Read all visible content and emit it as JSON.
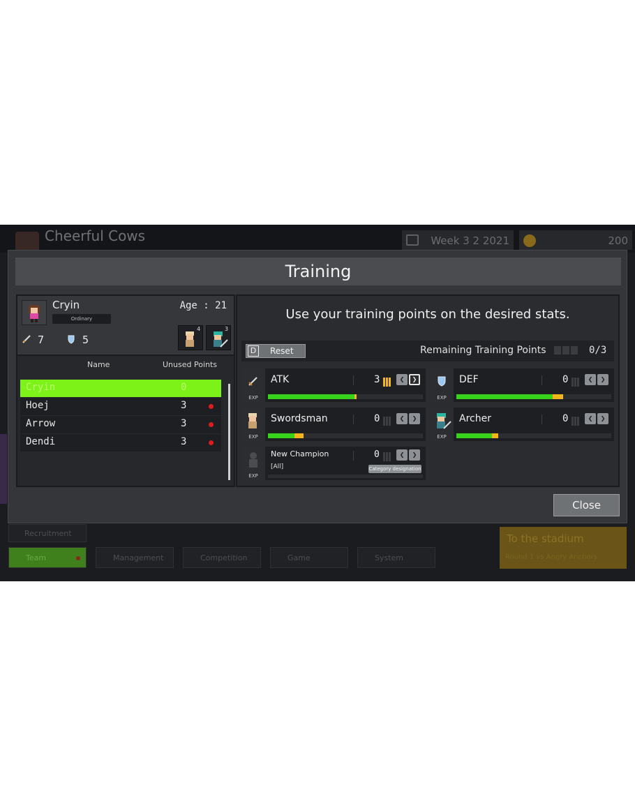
{
  "background": {
    "team_name": "Cheerful Cows",
    "week": "Week 3 2 2021",
    "gold": "200",
    "nav": {
      "recruitment": "Recruitment",
      "team": "Team",
      "management": "Management",
      "competition": "Competition",
      "game": "Game",
      "system": "System"
    },
    "stadium": {
      "title": "To the stadium",
      "subtitle": "Round 1 vs Angry Anchors"
    }
  },
  "modal": {
    "title": "Training",
    "instruction": "Use your training points on the desired stats.",
    "close_label": "Close"
  },
  "profile": {
    "name": "Cryin",
    "rank": "Ordinary",
    "age_label": "Age : 21",
    "atk": "7",
    "def": "5",
    "swordsman_count": "4",
    "archer_count": "3"
  },
  "roster": {
    "col_name": "Name",
    "col_points": "Unused Points",
    "rows": [
      {
        "name": "Cryin",
        "points": "0",
        "selected": true
      },
      {
        "name": "Hoej",
        "points": "3",
        "selected": false
      },
      {
        "name": "Arrow",
        "points": "3",
        "selected": false
      },
      {
        "name": "Dendi",
        "points": "3",
        "selected": false
      }
    ]
  },
  "toolbar": {
    "reset_key": "D",
    "reset_label": "Reset",
    "remaining_label": "Remaining Training Points",
    "remaining_value": "0/3"
  },
  "stats": {
    "exp_label": "EXP",
    "atk": {
      "label": "ATK",
      "value": "3",
      "exp_fraction": 0.56,
      "pending_fraction": 0.57
    },
    "def": {
      "label": "DEF",
      "value": "0",
      "exp_fraction": 0.62,
      "pending_fraction": 0.69
    },
    "swordsman": {
      "label": "Swordsman",
      "value": "0",
      "exp_fraction": 0.17,
      "pending_fraction": 0.23
    },
    "archer": {
      "label": "Archer",
      "value": "0",
      "exp_fraction": 0.23,
      "pending_fraction": 0.27
    },
    "champion": {
      "label": "New Champion",
      "sub": "[All]",
      "value": "0",
      "category_label": "Category designation",
      "exp_fraction": 0
    }
  },
  "colors": {
    "selected_row": "#7cf218",
    "exp_bar": "#39d21a",
    "pending_bar": "#f3b51a",
    "unused_dot": "#e11b1b"
  }
}
